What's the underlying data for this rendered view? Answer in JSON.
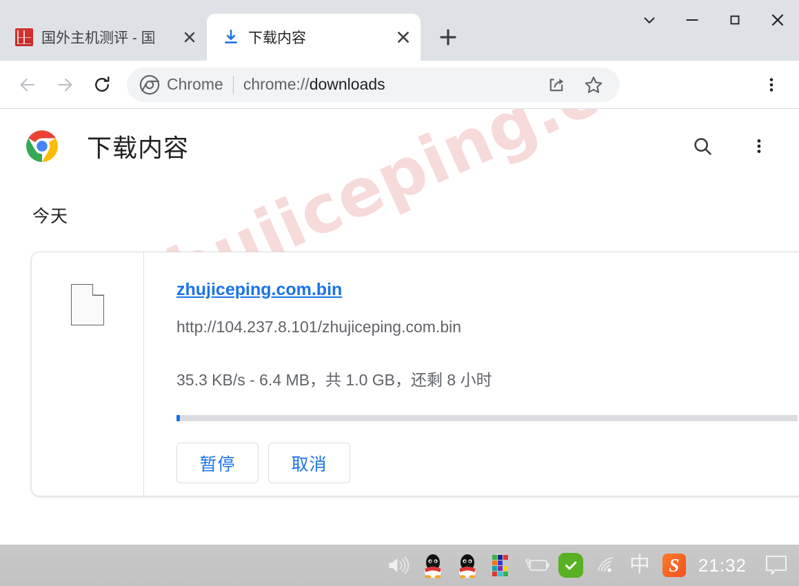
{
  "window": {
    "controls": {
      "tab_search": "tab-search",
      "minimize": "minimize",
      "maximize": "maximize",
      "close": "close"
    }
  },
  "tabs": [
    {
      "title": "国外主机测评 - 国",
      "favicon": "site-seal-icon",
      "active": false,
      "close_label": "×"
    },
    {
      "title": "下载内容",
      "favicon": "download-icon",
      "active": true,
      "close_label": "×"
    }
  ],
  "newtab": {
    "label": "+"
  },
  "toolbar": {
    "back": "back-arrow",
    "forward": "forward-arrow",
    "reload": "reload-icon",
    "omnibox": {
      "chip_label": "Chrome",
      "url_prefix": "chrome://",
      "url_strong": "downloads",
      "full_url": "chrome://downloads",
      "share": "share-icon",
      "bookmark": "star-icon"
    },
    "menu": "three-dot-menu"
  },
  "page": {
    "title": "下载内容",
    "logo": "chrome-logo",
    "search_icon": "search-icon",
    "menu_icon": "three-dot-menu",
    "watermark": "zhujiceping.com",
    "section_label": "今天",
    "download": {
      "file_icon": "generic-file-icon",
      "filename": "zhujiceping.com.bin",
      "url": "http://104.237.8.101/zhujiceping.com.bin",
      "status": "35.3 KB/s - 6.4 MB，共 1.0 GB，还剩 8 小时",
      "progress_percent": 0.6,
      "buttons": [
        {
          "label": "暂停",
          "name": "pause-button"
        },
        {
          "label": "取消",
          "name": "cancel-button"
        }
      ]
    }
  },
  "taskbar": {
    "items": [
      {
        "name": "volume-icon",
        "label": "volume"
      },
      {
        "name": "qq-icon-1",
        "label": "QQ"
      },
      {
        "name": "qq-icon-2",
        "label": "QQ"
      },
      {
        "name": "color-grid-icon",
        "label": "apps"
      },
      {
        "name": "battery-charging-icon",
        "label": "battery"
      },
      {
        "name": "security-check-icon",
        "label": "security"
      },
      {
        "name": "wifi-icon",
        "label": "wifi"
      },
      {
        "name": "ime-chinese-icon",
        "label": "中"
      },
      {
        "name": "sogou-icon",
        "label": "S"
      }
    ],
    "clock": "21:32",
    "notification_icon": "notification-bubble-icon"
  },
  "colors": {
    "accent_blue": "#1a73e8",
    "tabstrip_bg": "#dee1e6",
    "taskbar_bg": "#c6c6c6",
    "watermark": "#f7dada",
    "progress_track": "#dadce0"
  }
}
